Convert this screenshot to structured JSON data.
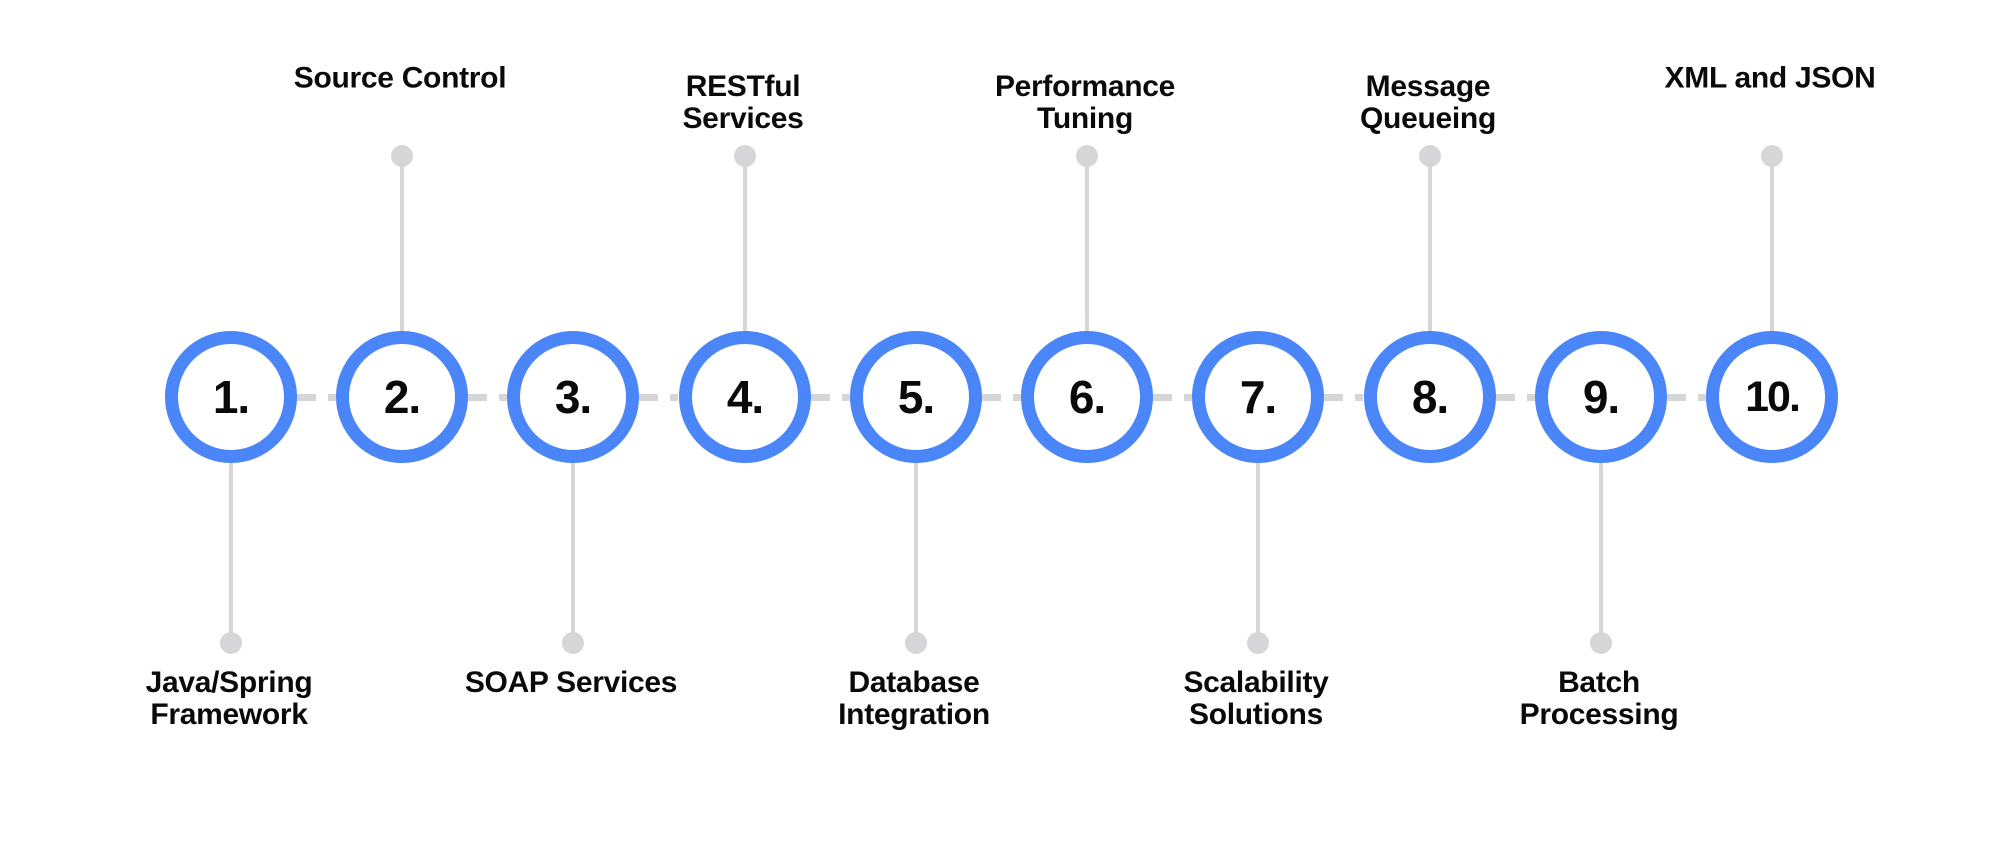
{
  "diagram": {
    "type": "numbered-timeline",
    "orientation": "horizontal",
    "node_count": 10,
    "accent_color": "#4a86f7",
    "connector_color": "#d6d6d8",
    "text_color": "#0a0a0a",
    "background_color": "#ffffff"
  },
  "steps": [
    {
      "number": "1.",
      "label": "Java/Spring\nFramework",
      "position": "below"
    },
    {
      "number": "2.",
      "label": "Source Control",
      "position": "above"
    },
    {
      "number": "3.",
      "label": "SOAP Services",
      "position": "below"
    },
    {
      "number": "4.",
      "label": "RESTful\nServices",
      "position": "above"
    },
    {
      "number": "5.",
      "label": "Database\nIntegration",
      "position": "below"
    },
    {
      "number": "6.",
      "label": "Performance\nTuning",
      "position": "above"
    },
    {
      "number": "7.",
      "label": "Scalability\nSolutions",
      "position": "below"
    },
    {
      "number": "8.",
      "label": "Message\nQueueing",
      "position": "above"
    },
    {
      "number": "9.",
      "label": "Batch\nProcessing",
      "position": "below"
    },
    {
      "number": "10.",
      "label": "XML and JSON",
      "position": "above"
    }
  ]
}
